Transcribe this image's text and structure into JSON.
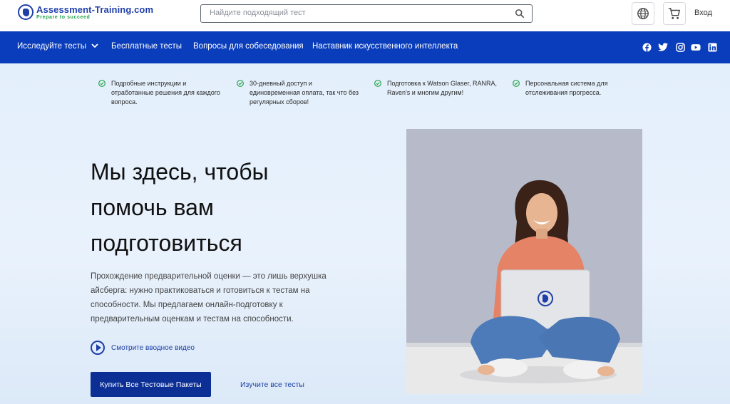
{
  "header": {
    "logo_name": "Assessment-Training.com",
    "logo_tagline": "Prepare to succeed",
    "search_placeholder": "Найдите подходящий тест",
    "login_label": "Вход"
  },
  "nav": {
    "items": [
      {
        "label": "Исследуйте тесты"
      },
      {
        "label": "Бесплатные тесты"
      },
      {
        "label": "Вопросы для собеседования"
      },
      {
        "label": "Наставник искусственного интеллекта"
      }
    ],
    "social": [
      "facebook-icon",
      "twitter-icon",
      "instagram-icon",
      "youtube-icon",
      "linkedin-icon"
    ]
  },
  "features": [
    {
      "text": "Подробные инструкции и отработанные решения для каждого вопроса."
    },
    {
      "text": "30-дневный доступ и единовременная оплата, так что без регулярных сборов!"
    },
    {
      "text": "Подготовка к Watson Glaser, RANRA, Raven's и многим другим!"
    },
    {
      "text": "Персональная система для отслеживания прогресса."
    }
  ],
  "hero": {
    "headline": "Мы здесь, чтобы помочь вам подготовиться",
    "description": "Прохождение предварительной оценки — это лишь верхушка айсберга: нужно практиковаться и готовиться к тестам на способности. Мы предлагаем онлайн-подготовку к предварительным оценкам и тестам на способности.",
    "video_label": "Смотрите вводное видео",
    "cta_label": "Купить Все Тестовые Пакеты",
    "secondary_label": "Изучите все тесты"
  },
  "colors": {
    "brand_blue": "#0a3dbb",
    "cta_blue": "#0c2f96",
    "check_green": "#22a34a"
  }
}
